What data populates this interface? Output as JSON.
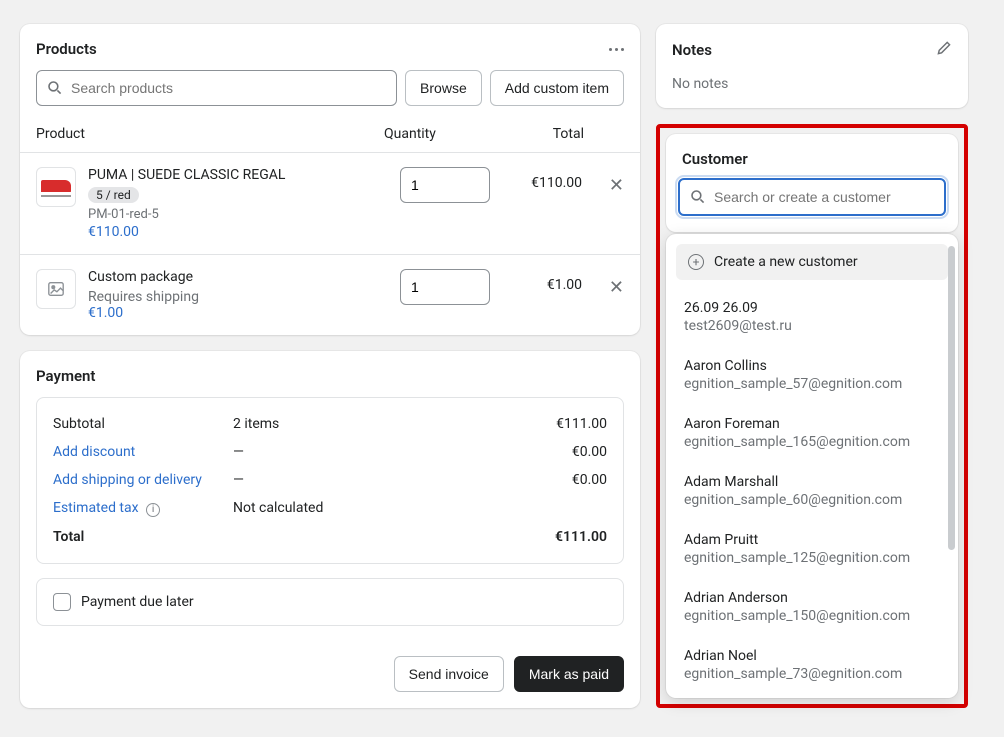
{
  "products": {
    "title": "Products",
    "search_placeholder": "Search products",
    "browse_btn": "Browse",
    "add_custom_btn": "Add custom item",
    "columns": {
      "product": "Product",
      "quantity": "Quantity",
      "total": "Total"
    },
    "items": [
      {
        "title": "PUMA | SUEDE CLASSIC REGAL",
        "variant": "5 / red",
        "sku": "PM-01-red-5",
        "price": "€110.00",
        "qty": "1",
        "total": "€110.00",
        "has_image": true
      },
      {
        "title": "Custom package",
        "subtitle": "Requires shipping",
        "price": "€1.00",
        "qty": "1",
        "total": "€1.00",
        "has_image": false
      }
    ]
  },
  "payment": {
    "title": "Payment",
    "rows": {
      "subtotal_label": "Subtotal",
      "subtotal_mid": "2 items",
      "subtotal_amt": "€111.00",
      "discount_label": "Add discount",
      "discount_mid": "—",
      "discount_amt": "€0.00",
      "shipping_label": "Add shipping or delivery",
      "shipping_mid": "—",
      "shipping_amt": "€0.00",
      "tax_label": "Estimated tax",
      "tax_mid": "Not calculated",
      "total_label": "Total",
      "total_amt": "€111.00"
    },
    "due_later": "Payment due later",
    "send_invoice": "Send invoice",
    "mark_paid": "Mark as paid"
  },
  "notes": {
    "title": "Notes",
    "empty": "No notes"
  },
  "customer": {
    "title": "Customer",
    "search_placeholder": "Search or create a customer",
    "create_label": "Create a new customer",
    "options": [
      {
        "name": "26.09 26.09",
        "email": "test2609@test.ru"
      },
      {
        "name": "Aaron Collins",
        "email": "egnition_sample_57@egnition.com"
      },
      {
        "name": "Aaron Foreman",
        "email": "egnition_sample_165@egnition.com"
      },
      {
        "name": "Adam Marshall",
        "email": "egnition_sample_60@egnition.com"
      },
      {
        "name": "Adam Pruitt",
        "email": "egnition_sample_125@egnition.com"
      },
      {
        "name": "Adrian Anderson",
        "email": "egnition_sample_150@egnition.com"
      },
      {
        "name": "Adrian Noel",
        "email": "egnition_sample_73@egnition.com"
      }
    ]
  }
}
